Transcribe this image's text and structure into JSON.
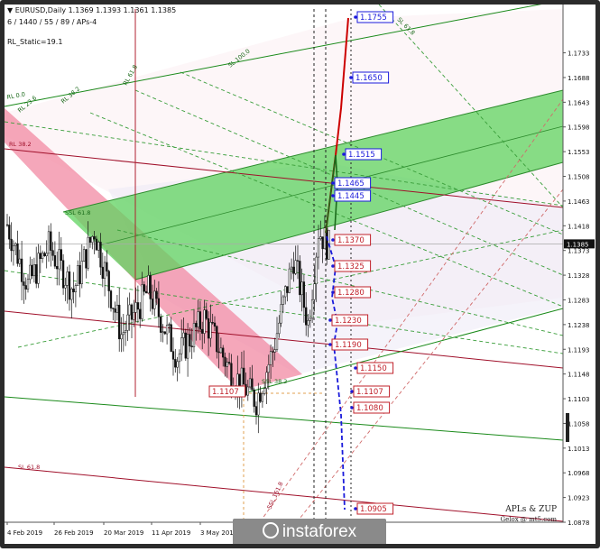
{
  "header": {
    "symbol_line": "EURUSD,Daily  1.1369 1.1393 1.1361 1.1385",
    "params_line": "6 / 1440 / 55 / 89 / APs-4",
    "static_label": "RL_Static=19.1"
  },
  "watermark": {
    "text": "instaforex"
  },
  "brand": {
    "title": "APLs & ZUP",
    "subtitle": "Gelox @ mt5.com"
  },
  "chart_data": {
    "type": "candlestick",
    "title": "EURUSD,Daily",
    "current_price": "1.1385",
    "y_axis": {
      "range": [
        1.0878,
        1.1775
      ],
      "ticks": [
        "1.1733",
        "1.1688",
        "1.1643",
        "1.1598",
        "1.1553",
        "1.1508",
        "1.1463",
        "1.1418",
        "1.1373",
        "1.1328",
        "1.1283",
        "1.1238",
        "1.1193",
        "1.1148",
        "1.1103",
        "1.1058",
        "1.1013",
        "1.0968",
        "1.0923",
        "1.0878"
      ]
    },
    "x_axis": {
      "ticks": [
        "4 Feb 2019",
        "26 Feb 2019",
        "20 Mar 2019",
        "11 Apr 2019",
        "3 May 2019"
      ]
    },
    "candles": [],
    "target_levels": {
      "upper": [
        "1.1755",
        "1.1650",
        "1.1515",
        "1.1465",
        "1.1445"
      ],
      "lower": [
        "1.1370",
        "1.1325",
        "1.1280",
        "1.1230",
        "1.1190",
        "1.1150",
        "1.1107",
        "1.1080",
        "1.0905"
      ],
      "low_marker": "1.1107"
    },
    "fib_labels": [
      "RL 38.2",
      "SSL 61.8",
      "SL 61.8",
      "SL 100.0",
      "RL 23.6",
      "RL 38.2",
      "RL 61.8",
      "RL 0.0",
      "SSL 38.2",
      "SSL 161.8",
      "SL 61.8"
    ],
    "colors": {
      "up_target": "#cc0000",
      "down_target": "#1a1adb",
      "green_channel": "#5fd35f",
      "pink_channel": "#f28aa3",
      "dark_red_line": "#a0102a",
      "green_line": "#1a8a1a",
      "upper_box_label": "#1a1adb",
      "lower_box_label": "#c0202a"
    }
  }
}
